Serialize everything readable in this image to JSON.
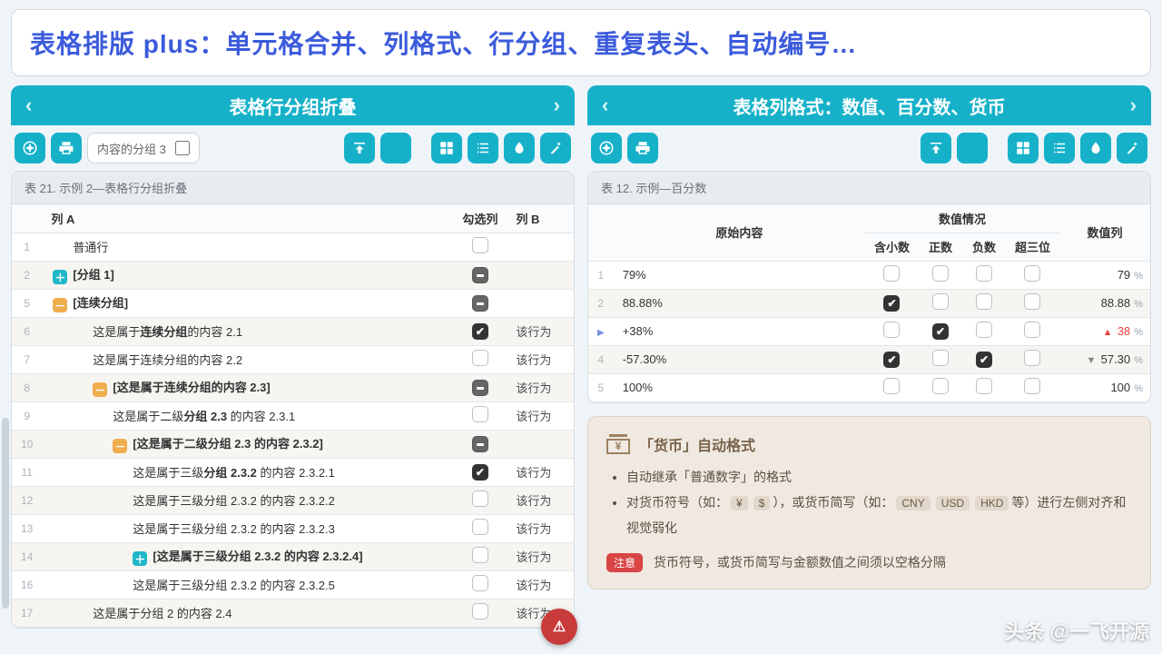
{
  "banner": "表格排版 plus：单元格合并、列格式、行分组、重复表头、自动编号…",
  "left": {
    "title": "表格行分组折叠",
    "toolfield_text": "内容的分组 3",
    "table_caption": "表 21. 示例 2—表格行分组折叠",
    "headers": {
      "colA": "列 A",
      "check": "勾选列",
      "colB": "列 B"
    },
    "rows": [
      {
        "n": "1",
        "indent": 1,
        "tog": "",
        "text": "普通行",
        "bold": false,
        "chk": "empty",
        "b": ""
      },
      {
        "n": "2",
        "indent": 0,
        "tog": "plus",
        "text": "[分组 1]",
        "bold": true,
        "chk": "mix",
        "b": ""
      },
      {
        "n": "5",
        "indent": 0,
        "tog": "minus",
        "text": "[连续分组]",
        "bold": true,
        "chk": "mix",
        "b": ""
      },
      {
        "n": "6",
        "indent": 2,
        "tog": "",
        "text_parts": [
          "这是属于",
          "连续分组",
          "的内容 2.1"
        ],
        "bold": false,
        "chk": "checked",
        "b": "该行为"
      },
      {
        "n": "7",
        "indent": 2,
        "tog": "",
        "text": "这是属于连续分组的内容 2.2",
        "bold": false,
        "chk": "empty",
        "b": "该行为"
      },
      {
        "n": "8",
        "indent": 2,
        "tog": "minus",
        "text": "[这是属于连续分组的内容 2.3]",
        "bold": true,
        "chk": "mix",
        "b": "该行为"
      },
      {
        "n": "9",
        "indent": 3,
        "tog": "",
        "text_parts": [
          "这是属于二级",
          "分组 2.3",
          " 的内容 2.3.1"
        ],
        "bold": false,
        "chk": "empty",
        "b": "该行为"
      },
      {
        "n": "10",
        "indent": 3,
        "tog": "minus",
        "text": "[这是属于二级分组 2.3 的内容 2.3.2]",
        "bold": true,
        "chk": "mix",
        "b": ""
      },
      {
        "n": "11",
        "indent": 4,
        "tog": "",
        "text_parts": [
          "这是属于三级",
          "分组 2.3.2",
          " 的内容 2.3.2.1"
        ],
        "bold": false,
        "chk": "checked",
        "b": "该行为"
      },
      {
        "n": "12",
        "indent": 4,
        "tog": "",
        "text": "这是属于三级分组 2.3.2 的内容 2.3.2.2",
        "bold": false,
        "chk": "empty",
        "b": "该行为"
      },
      {
        "n": "13",
        "indent": 4,
        "tog": "",
        "text": "这是属于三级分组 2.3.2 的内容 2.3.2.3",
        "bold": false,
        "chk": "empty",
        "b": "该行为"
      },
      {
        "n": "14",
        "indent": 4,
        "tog": "plus",
        "text": "[这是属于三级分组 2.3.2 的内容 2.3.2.4]",
        "bold": true,
        "chk": "empty",
        "b": "该行为"
      },
      {
        "n": "16",
        "indent": 4,
        "tog": "",
        "text": "这是属于三级分组 2.3.2 的内容 2.3.2.5",
        "bold": false,
        "chk": "empty",
        "b": "该行为"
      },
      {
        "n": "17",
        "indent": 2,
        "tog": "",
        "text": "这是属于分组 2 的内容 2.4",
        "bold": false,
        "chk": "empty",
        "b": "该行为"
      }
    ]
  },
  "right": {
    "title": "表格列格式：数值、百分数、货币",
    "table_caption": "表 12. 示例—百分数",
    "headers": {
      "raw": "原始内容",
      "grp": "数值情况",
      "dec": "含小数",
      "pos": "正数",
      "neg": "负数",
      "tri": "超三位",
      "val": "数值列"
    },
    "rows": [
      {
        "n": "1",
        "raw": "79%",
        "dec": false,
        "pos": false,
        "neg": false,
        "tri": false,
        "arrow": "",
        "val": "79",
        "unit": "%"
      },
      {
        "n": "2",
        "raw": "88.88%",
        "dec": true,
        "pos": false,
        "neg": false,
        "tri": false,
        "arrow": "",
        "val": "88.88",
        "unit": "%"
      },
      {
        "n": "",
        "ptr": true,
        "raw": "+38%",
        "dec": false,
        "pos": true,
        "neg": false,
        "tri": false,
        "arrow": "up",
        "val": "38",
        "unit": "%"
      },
      {
        "n": "4",
        "raw": "-57.30%",
        "dec": true,
        "pos": false,
        "neg": true,
        "tri": false,
        "arrow": "down",
        "val": "57.30",
        "unit": "%"
      },
      {
        "n": "5",
        "raw": "100%",
        "dec": false,
        "pos": false,
        "neg": false,
        "tri": false,
        "arrow": "",
        "val": "100",
        "unit": "%"
      }
    ],
    "info": {
      "title": "「货币」自动格式",
      "bullets_raw": [
        "自动继承「普通数字」的格式",
        "对货币符号（如：¥ $），或货币简写（如：CNY USD HKD 等）进行左侧对齐和视觉弱化"
      ],
      "note_label": "注意",
      "note_text": "货币符号，或货币简写与金额数值之间须以空格分隔",
      "pill_yen": "¥",
      "pill_usd": "$",
      "pill_cny": "CNY",
      "pill_usd2": "USD",
      "pill_hkd": "HKD",
      "pill_etc": "等"
    }
  },
  "watermark": "头条 @一飞开源",
  "icons": {
    "nav": "❖",
    "print": "🖶",
    "up": "⇧",
    "moon": "☽",
    "grid": "▦",
    "list": "≡",
    "drop": "⚙",
    "wand": "✦"
  }
}
